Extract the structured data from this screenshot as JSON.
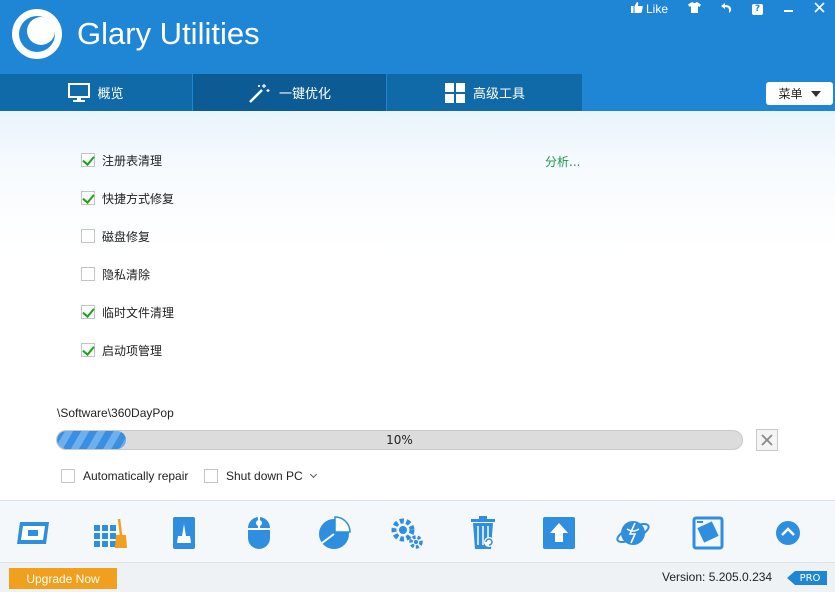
{
  "header": {
    "app_title": "Glary Utilities",
    "like_label": "Like",
    "logo_icon": "glary-logo-icon"
  },
  "window_controls": [
    {
      "name": "like-button",
      "icon": "thumbs-up-icon",
      "label": "Like"
    },
    {
      "name": "skin-button",
      "icon": "tshirt-icon"
    },
    {
      "name": "back-button",
      "icon": "undo-arrow-icon"
    },
    {
      "name": "help-button",
      "icon": "help-icon",
      "label": "?"
    },
    {
      "name": "minimize-button",
      "icon": "minimize-icon"
    },
    {
      "name": "close-button",
      "icon": "close-icon"
    }
  ],
  "tabs": [
    {
      "label": "概览",
      "icon": "monitor-icon",
      "active": false
    },
    {
      "label": "一键优化",
      "icon": "magic-wand-icon",
      "active": true
    },
    {
      "label": "高级工具",
      "icon": "grid-icon",
      "active": false
    }
  ],
  "menu_button": {
    "label": "菜单"
  },
  "options": [
    {
      "label": "注册表清理",
      "checked": true
    },
    {
      "label": "快捷方式修复",
      "checked": true
    },
    {
      "label": "磁盘修复",
      "checked": false
    },
    {
      "label": "隐私清除",
      "checked": false
    },
    {
      "label": "临时文件清理",
      "checked": true
    },
    {
      "label": "启动项管理",
      "checked": true
    }
  ],
  "analyze_link": "分析...",
  "scan": {
    "current_path": "\\Software\\360DayPop",
    "progress_percent": 10,
    "progress_text": "10%"
  },
  "bottom_options": {
    "auto_repair": {
      "label": "Automatically repair",
      "checked": false
    },
    "shutdown": {
      "label": "Shut down PC",
      "checked": false
    }
  },
  "toolbar_icons": [
    "disk-cleaner-icon",
    "registry-cleaner-icon",
    "disk-repair-icon",
    "mouse-icon",
    "pie-chart-icon",
    "gears-icon",
    "recycle-bin-icon",
    "upload-arrow-icon",
    "planet-icon",
    "file-tools-icon",
    "chevron-up-icon"
  ],
  "status": {
    "upgrade_label": "Upgrade Now",
    "version_text": "Version: 5.205.0.234",
    "pro_badge": "PRO"
  },
  "colors": {
    "header_blue": "#1f86d6",
    "tab_dark": "#0c5b95",
    "check_green": "#1aa21a",
    "link_green": "#1c9a4a",
    "upgrade_orange": "#f0a01c"
  }
}
